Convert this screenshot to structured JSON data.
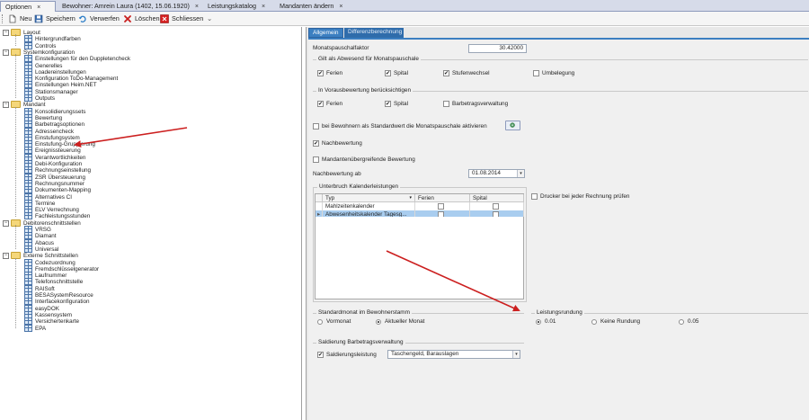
{
  "tabs": [
    {
      "label": "Optionen",
      "close": "×"
    },
    {
      "label": "Bewohner: Amrein Laura (1402, 15.06.1920)",
      "close": "×"
    },
    {
      "label": "Leistungskatalog",
      "close": "×"
    },
    {
      "label": "Mandanten ändern",
      "close": "×"
    }
  ],
  "toolbar": {
    "new": "Neu",
    "save": "Speichern",
    "discard": "Verwerfen",
    "delete": "Löschen",
    "close": "Schliessen",
    "overflow": "⌄"
  },
  "tree": {
    "groups": [
      {
        "label": "Layout",
        "toggle": "−",
        "children": [
          "Hintergrundfarben",
          "Controls"
        ]
      },
      {
        "label": "Systemkonfiguration",
        "toggle": "−",
        "children": [
          "Einstellungen für den Duppletencheck",
          "Generelles",
          "Loadereinstellungen",
          "Konfiguration ToDo-Management",
          "Einstellungen Heim.NET",
          "Stationsmanager",
          "Outputs"
        ]
      },
      {
        "label": "Mandant",
        "toggle": "−",
        "children": [
          "Konsolidierungssets",
          "Bewertung",
          "Barbetragsoptionen",
          "Adressencheck",
          "Einstufungsystem",
          "Einstufung-Gruppierung",
          "Ereignissteuerung",
          "Verantwortlichkeiten",
          "Debi-Konfiguration",
          "Rechnungseinstellung",
          "ZSR Übersteuerung",
          "Rechnungsnummer",
          "Dokumenten-Mapping",
          "Alternatives CI",
          "Termine",
          "ELV Verrechnung",
          "Fachleistungsstunden"
        ]
      },
      {
        "label": "Debitorenschnittstellen",
        "toggle": "−",
        "children": [
          "VRSG",
          "Diamant",
          "Abacus",
          "Universal"
        ]
      },
      {
        "label": "Externe Schnittstellen",
        "toggle": "−",
        "children": [
          "Codezuordnung",
          "Fremdschlüsselgenerator",
          "Laufnummer",
          "Telefonschnittstelle",
          "RAISoft",
          "BESASystemResource",
          "Interfacekonfiguration",
          "easyDOK",
          "Kassensystem",
          "Versichertenkarte",
          "EPA"
        ]
      }
    ]
  },
  "panel": {
    "tabs": [
      "Allgemein",
      "Differenzberechnung"
    ],
    "monatspauschalfaktor_label": "Monatspauschalfaktor",
    "monatspauschalfaktor_value": "30.42000",
    "group_abwesend": "Gilt als Abwesend für Monatspauschale",
    "abwesend": [
      {
        "label": "Ferien",
        "checked": true
      },
      {
        "label": "Spital",
        "checked": true
      },
      {
        "label": "Stufenwechsel",
        "checked": true
      },
      {
        "label": "Umbelegung",
        "checked": false
      }
    ],
    "group_voraus": "In Vorausbewertung berücksichtigen",
    "voraus": [
      {
        "label": "Ferien",
        "checked": true
      },
      {
        "label": "Spital",
        "checked": true
      },
      {
        "label": "Barbetragsverwaltung",
        "checked": false
      }
    ],
    "standard_monatspauschale": "bei Bewohnern als Standardwert die Monatspauschale aktivieren",
    "nachbewertung": "Nachbewertung",
    "mandantenuebergreifend": "Mandantenübergreifende Bewertung",
    "nachbewertung_ab_label": "Nachbewertung ab",
    "nachbewertung_ab_value": "01.08.2014",
    "dropdown_glyph": "▾",
    "group_unterbruch": "Unterbruch Kalenderleistungen",
    "grid_headers": {
      "typ": "Typ",
      "ferien": "Ferien",
      "spital": "Spital",
      "filter": "▾"
    },
    "grid_rows": [
      {
        "indicator": "",
        "typ": "Mahlzeitenkalender"
      },
      {
        "indicator": "▸",
        "typ": "Abwesenheitskalender Tagesg..."
      }
    ],
    "drucker_label": "Drucker bei jeder Rechnung prüfen",
    "group_standardmonat": "Standardmonat im Bewohnerstamm",
    "standardmonat": [
      {
        "label": "Vormonat",
        "on": false
      },
      {
        "label": "Aktueller Monat",
        "on": true
      }
    ],
    "group_leistungsrundung": "Leistungsrundung",
    "leistungsrundung": [
      {
        "label": "0.01",
        "on": true
      },
      {
        "label": "Keine Rundung",
        "on": false
      },
      {
        "label": "0.05",
        "on": false
      }
    ],
    "group_saldierung": "Saldierung Barbetragsverwaltung",
    "saldierungsleistung_label": "Saldierungsleistung",
    "saldierungsleistung_value": "Taschengeld, Barauslagen"
  },
  "colors": {
    "tab_blue": "#3c7fc1",
    "arrow_red": "#cc1f1f",
    "selection": "#a9cdef"
  }
}
